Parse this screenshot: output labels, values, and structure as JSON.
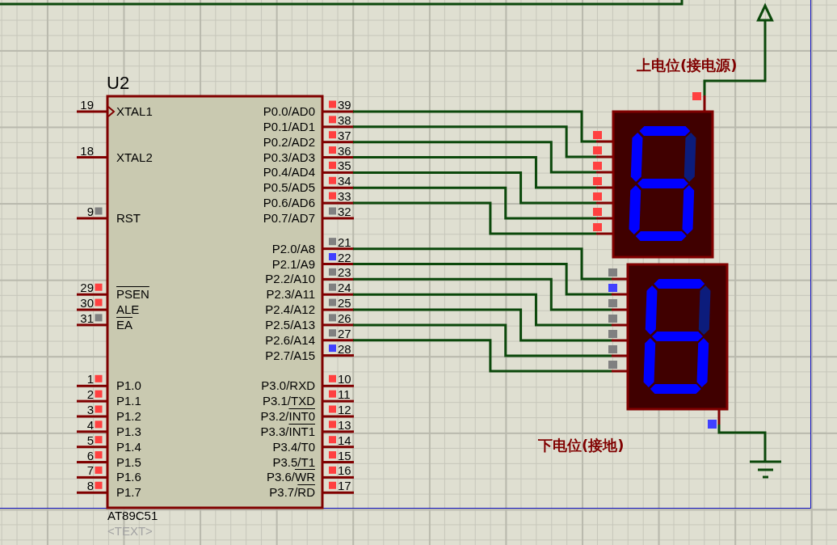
{
  "chip": {
    "ref": "U2",
    "part": "AT89C51",
    "default_text": "<TEXT>",
    "left_pins": [
      {
        "number": "19",
        "label": "XTAL1",
        "clock": true
      },
      {
        "number": "18",
        "label": "XTAL2",
        "clock": false
      },
      {
        "number": "9",
        "label": "RST",
        "clock": false,
        "color": "#808080"
      },
      {
        "number": "29",
        "overline": "PSEN",
        "clock": false,
        "color": "#ff4040"
      },
      {
        "number": "30",
        "label": "ALE",
        "clock": false,
        "color": "#ff4040"
      },
      {
        "number": "31",
        "overline": "EA",
        "clock": false,
        "color": "#808080"
      },
      {
        "number": "1",
        "label": "P1.0",
        "clock": false,
        "color": "#ff4040"
      },
      {
        "number": "2",
        "label": "P1.1",
        "clock": false,
        "color": "#ff4040"
      },
      {
        "number": "3",
        "label": "P1.2",
        "clock": false,
        "color": "#ff4040"
      },
      {
        "number": "4",
        "label": "P1.3",
        "clock": false,
        "color": "#ff4040"
      },
      {
        "number": "5",
        "label": "P1.4",
        "clock": false,
        "color": "#ff4040"
      },
      {
        "number": "6",
        "label": "P1.5",
        "clock": false,
        "color": "#ff4040"
      },
      {
        "number": "7",
        "label": "P1.6",
        "clock": false,
        "color": "#ff4040"
      },
      {
        "number": "8",
        "label": "P1.7",
        "clock": false,
        "color": "#ff4040"
      }
    ],
    "right_pins": [
      {
        "number": "39",
        "label": "P0.0/AD0",
        "color": "#ff4040"
      },
      {
        "number": "38",
        "label": "P0.1/AD1",
        "color": "#ff4040"
      },
      {
        "number": "37",
        "label": "P0.2/AD2",
        "color": "#ff4040"
      },
      {
        "number": "36",
        "label": "P0.3/AD3",
        "color": "#ff4040"
      },
      {
        "number": "35",
        "label": "P0.4/AD4",
        "color": "#ff4040"
      },
      {
        "number": "34",
        "label": "P0.5/AD5",
        "color": "#ff4040"
      },
      {
        "number": "33",
        "label": "P0.6/AD6",
        "color": "#ff4040"
      },
      {
        "number": "32",
        "label": "P0.7/AD7",
        "color": "#808080"
      },
      {
        "number": "21",
        "label": "P2.0/A8",
        "color": "#808080"
      },
      {
        "number": "22",
        "label": "P2.1/A9",
        "color": "#4040ff"
      },
      {
        "number": "23",
        "label": "P2.2/A10",
        "color": "#808080"
      },
      {
        "number": "24",
        "label": "P2.3/A11",
        "color": "#808080"
      },
      {
        "number": "25",
        "label": "P2.4/A12",
        "color": "#808080"
      },
      {
        "number": "26",
        "label": "P2.5/A13",
        "color": "#808080"
      },
      {
        "number": "27",
        "label": "P2.6/A14",
        "color": "#808080"
      },
      {
        "number": "28",
        "label": "P2.7/A15",
        "color": "#4040ff"
      },
      {
        "number": "10",
        "label": "P3.0/RXD",
        "color": "#ff4040"
      },
      {
        "number": "11",
        "label": "P3.1/TXD",
        "color": "#ff4040"
      },
      {
        "number": "12",
        "label": "P3.2/",
        "overline": "INT0",
        "color": "#ff4040"
      },
      {
        "number": "13",
        "label": "P3.3/",
        "overline": "INT1",
        "color": "#ff4040"
      },
      {
        "number": "14",
        "label": "P3.4/T0",
        "color": "#ff4040"
      },
      {
        "number": "15",
        "label": "P3.5/T1",
        "color": "#ff4040"
      },
      {
        "number": "16",
        "label": "P3.6/",
        "overline": "WR",
        "color": "#ff4040"
      },
      {
        "number": "17",
        "label": "P3.7/",
        "overline": "RD",
        "color": "#ff4040"
      }
    ]
  },
  "displays": [
    {
      "kind": "common-anode",
      "label": "上电位(接电源)",
      "common": {
        "color": "#ff4040"
      },
      "segments": {
        "a": true,
        "b": false,
        "c": true,
        "d": true,
        "e": true,
        "f": true,
        "g": true
      },
      "pins": [
        {
          "color": "#ff4040"
        },
        {
          "color": "#ff4040"
        },
        {
          "color": "#ff4040"
        },
        {
          "color": "#ff4040"
        },
        {
          "color": "#ff4040"
        },
        {
          "color": "#ff4040"
        },
        {
          "color": "#ff4040"
        }
      ]
    },
    {
      "kind": "common-cathode",
      "label": "下电位(接地)",
      "common": {
        "color": "#4040ff"
      },
      "segments": {
        "a": true,
        "b": false,
        "c": true,
        "d": true,
        "e": true,
        "f": true,
        "g": true
      },
      "pins": [
        {
          "color": "#808080"
        },
        {
          "color": "#4040ff"
        },
        {
          "color": "#808080"
        },
        {
          "color": "#808080"
        },
        {
          "color": "#808080"
        },
        {
          "color": "#808080"
        },
        {
          "color": "#808080"
        }
      ]
    }
  ]
}
